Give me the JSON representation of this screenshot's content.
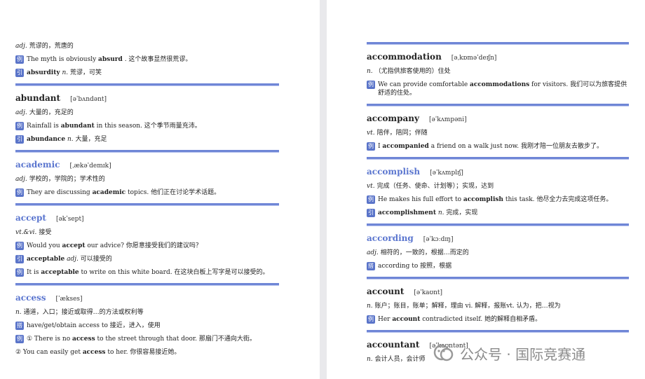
{
  "left_page": {
    "top_fragment": {
      "meaning": {
        "pos": "adj.",
        "text": "荒谬的，荒唐的"
      },
      "lines": [
        {
          "tag": "例",
          "parts": [
            {
              "t": "The myth is obviously "
            },
            {
              "t": "absurd",
              "b": true
            },
            {
              "t": " . 这个故事显然很荒谬。"
            }
          ]
        },
        {
          "tag": "引",
          "parts": [
            {
              "t": "absurdity",
              "b": true
            },
            {
              "t": " "
            },
            {
              "t": "n.",
              "i": true
            },
            {
              "t": " 荒谬，可笑"
            }
          ]
        }
      ]
    },
    "entries": [
      {
        "headword": "abundant",
        "ipa": "[əˈbʌndənt]",
        "color": "dark",
        "meaning": {
          "pos": "adj.",
          "text": "大量的，充足的"
        },
        "lines": [
          {
            "tag": "例",
            "parts": [
              {
                "t": "Rainfall is "
              },
              {
                "t": "abundant",
                "b": true
              },
              {
                "t": " in this season. 这个季节雨量充沛。"
              }
            ]
          },
          {
            "tag": "引",
            "parts": [
              {
                "t": "abundance",
                "b": true
              },
              {
                "t": " "
              },
              {
                "t": "n.",
                "i": true
              },
              {
                "t": " 大量，充足"
              }
            ]
          }
        ]
      },
      {
        "headword": "academic",
        "ipa": "[ˌækəˈdemɪk]",
        "color": "blue",
        "meaning": {
          "pos": "adj.",
          "text": "学校的，学院的；学术性的"
        },
        "lines": [
          {
            "tag": "例",
            "parts": [
              {
                "t": "They are discussing "
              },
              {
                "t": "academic",
                "b": true
              },
              {
                "t": " topics. 他们正在讨论学术话题。"
              }
            ]
          }
        ]
      },
      {
        "headword": "accept",
        "ipa": "[əkˈsept]",
        "color": "blue",
        "meaning": {
          "pos": "vt.&vi.",
          "text": "接受"
        },
        "lines": [
          {
            "tag": "例",
            "parts": [
              {
                "t": "Would you "
              },
              {
                "t": "accept",
                "b": true
              },
              {
                "t": " our advice? 你愿意接受我们的建议吗？"
              }
            ]
          },
          {
            "tag": "引",
            "parts": [
              {
                "t": "acceptable",
                "b": true
              },
              {
                "t": " "
              },
              {
                "t": "adj.",
                "i": true
              },
              {
                "t": " 可以接受的"
              }
            ]
          },
          {
            "tag": "例",
            "parts": [
              {
                "t": "It is "
              },
              {
                "t": "acceptable",
                "b": true
              },
              {
                "t": " to write on this white board. 在这块白板上写字是可以接受的。"
              }
            ]
          }
        ]
      },
      {
        "headword": "access",
        "ipa": "[ˈækses]",
        "color": "blue",
        "meaning": {
          "pos": "n.",
          "text": "通道，入口；接近或取得…的方法或权利等"
        },
        "lines": [
          {
            "tag": "搭",
            "parts": [
              {
                "t": "have/get/obtain access to 接近，进入，使用"
              }
            ]
          },
          {
            "tag": "例",
            "parts": [
              {
                "t": "① There is no "
              },
              {
                "t": "access",
                "b": true
              },
              {
                "t": " to the street through that door. 那扇门不通向大街。"
              }
            ]
          },
          {
            "tag": "",
            "parts": [
              {
                "t": "② You can easily get "
              },
              {
                "t": "access",
                "b": true
              },
              {
                "t": " to her. 你很容易接近她。"
              }
            ]
          }
        ]
      }
    ]
  },
  "right_page": {
    "entries": [
      {
        "headword": "accommodation",
        "ipa": "[əˌkɒməˈdeɪʃn]",
        "color": "dark",
        "meaning": {
          "pos": "n.",
          "text": "（尤指供旅客使用的）住处"
        },
        "lines": [
          {
            "tag": "例",
            "parts": [
              {
                "t": "We can provide comfortable "
              },
              {
                "t": "accommodations",
                "b": true
              },
              {
                "t": " for visitors. 我们可以为旅客提供舒适的住处。"
              }
            ]
          }
        ]
      },
      {
        "headword": "accompany",
        "ipa": "[əˈkʌmpəni]",
        "color": "dark",
        "meaning": {
          "pos": "vt.",
          "text": "陪伴，陪同；伴随"
        },
        "lines": [
          {
            "tag": "例",
            "parts": [
              {
                "t": "I "
              },
              {
                "t": "accompanied",
                "b": true
              },
              {
                "t": " a friend on a walk just now. 我刚才陪一位朋友去散步了。"
              }
            ]
          }
        ]
      },
      {
        "headword": "accomplish",
        "ipa": "[əˈkʌmplɪʃ]",
        "color": "blue",
        "meaning": {
          "pos": "vt.",
          "text": "完成（任务、使命、计划等）；实现，达到"
        },
        "lines": [
          {
            "tag": "例",
            "parts": [
              {
                "t": "He makes his full effort to "
              },
              {
                "t": "accomplish",
                "b": true
              },
              {
                "t": " this task. 他尽全力去完成这项任务。"
              }
            ]
          },
          {
            "tag": "引",
            "parts": [
              {
                "t": "accomplishment",
                "b": true
              },
              {
                "t": " "
              },
              {
                "t": "n.",
                "i": true
              },
              {
                "t": " 完成，实现"
              }
            ]
          }
        ]
      },
      {
        "headword": "according",
        "ipa": "[əˈkɔːdɪŋ]",
        "color": "blue",
        "meaning": {
          "pos": "adj.",
          "text": "相符的，一致的，根据…而定的"
        },
        "lines": [
          {
            "tag": "搭",
            "parts": [
              {
                "t": "according to 按照，根据"
              }
            ]
          }
        ]
      },
      {
        "headword": "account",
        "ipa": "[əˈkaʊnt]",
        "color": "dark",
        "meaning": {
          "pos": "n.",
          "text": "账户；账目，账单；解释，理由 vi. 解释，报账vt. 认为，把…视为"
        },
        "lines": [
          {
            "tag": "例",
            "parts": [
              {
                "t": "Her "
              },
              {
                "t": "account",
                "b": true
              },
              {
                "t": " contradicted itself. 她的解释自相矛盾。"
              }
            ]
          }
        ]
      },
      {
        "headword": "accountant",
        "ipa": "[əˈkaʊntənt]",
        "color": "dark",
        "meaning": {
          "pos": "n.",
          "text": "会计人员，会计师"
        },
        "lines": []
      }
    ]
  },
  "watermark": {
    "text": "公众号 · 国际竞赛通",
    "icon": "wechat-official-account-icon"
  },
  "colors": {
    "accent": "#5b76cf",
    "rule": "#6f86d6",
    "tag_bg": "#5a74c9"
  }
}
